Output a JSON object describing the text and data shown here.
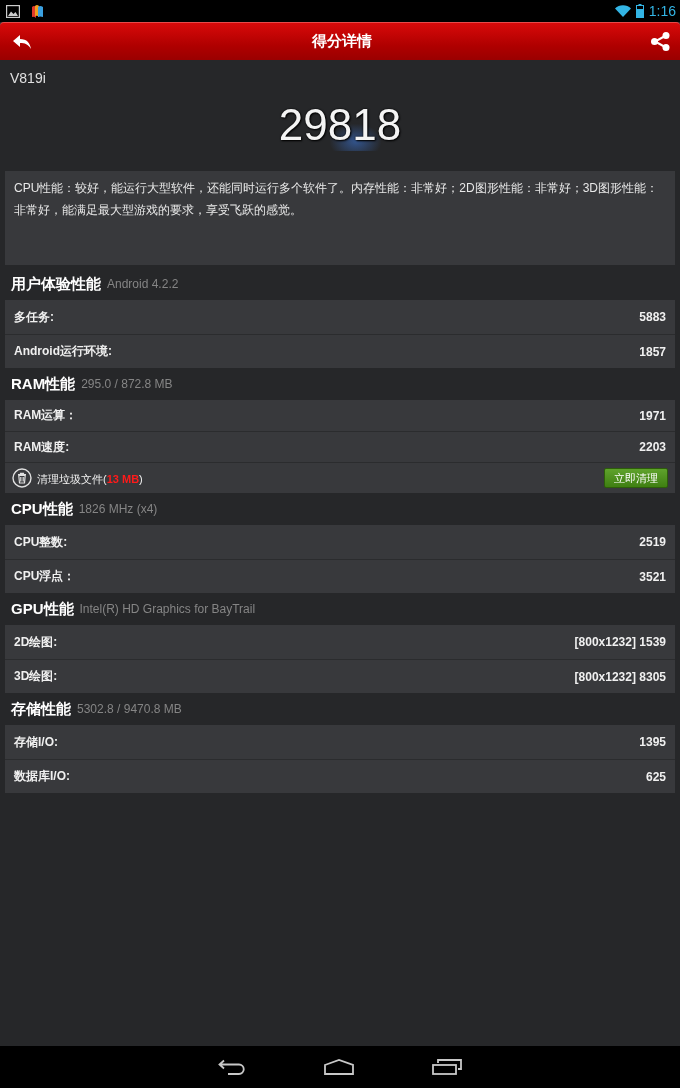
{
  "status_bar": {
    "time": "1:16"
  },
  "header": {
    "title": "得分详情"
  },
  "device": "V819i",
  "score": "29818",
  "summary": "CPU性能：较好，能运行大型软件，还能同时运行多个软件了。内存性能：非常好；2D图形性能：非常好；3D图形性能：非常好，能满足最大型游戏的要求，享受飞跃的感觉。",
  "sections": [
    {
      "title": "用户体验性能",
      "subtitle": "Android 4.2.2",
      "rows": [
        {
          "kind": "score",
          "label": "多任务:",
          "value": "5883"
        },
        {
          "kind": "score",
          "label": "Android运行环境:",
          "value": "1857"
        }
      ]
    },
    {
      "title": "RAM性能",
      "subtitle": "295.0 / 872.8 MB",
      "rows": [
        {
          "kind": "score",
          "label": "RAM运算：",
          "value": "1971"
        },
        {
          "kind": "score",
          "label": "RAM速度:",
          "value": "2203"
        },
        {
          "kind": "cleanup",
          "label": "清理垃圾文件(**13 MB**)",
          "button": "立即清理"
        }
      ]
    },
    {
      "title": "CPU性能",
      "subtitle": "1826 MHz (x4)",
      "rows": [
        {
          "kind": "score",
          "label": "CPU整数:",
          "value": "2519"
        },
        {
          "kind": "score",
          "label": "CPU浮点：",
          "value": "3521"
        }
      ]
    },
    {
      "title": "GPU性能",
      "subtitle": "Intel(R) HD Graphics for BayTrail",
      "rows": [
        {
          "kind": "score",
          "label": "2D绘图:",
          "value": "[800x1232] 1539"
        },
        {
          "kind": "score",
          "label": "3D绘图:",
          "value": "[800x1232] 8305"
        }
      ]
    },
    {
      "title": "存储性能",
      "subtitle": "5302.8 / 9470.8 MB",
      "rows": [
        {
          "kind": "score",
          "label": "存储I/O:",
          "value": "1395"
        },
        {
          "kind": "score",
          "label": "数据库I/O:",
          "value": "625"
        }
      ]
    }
  ]
}
